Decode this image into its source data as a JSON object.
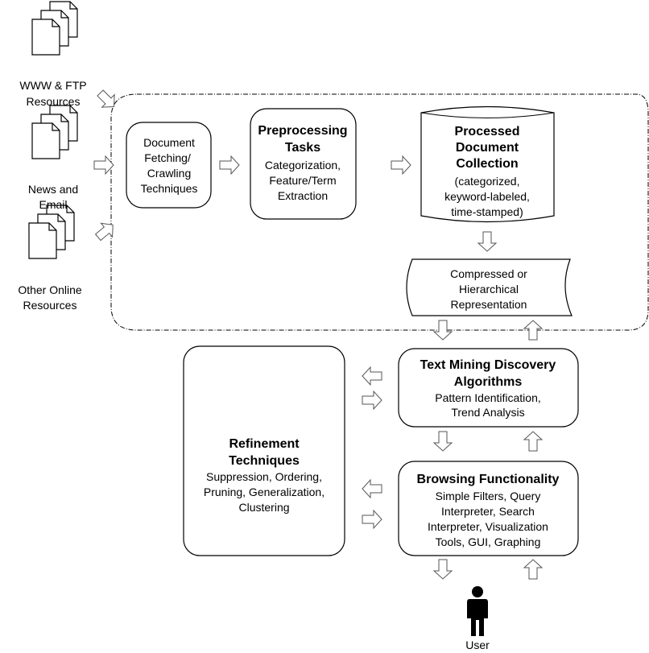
{
  "sources": [
    {
      "lines": [
        "WWW & FTP",
        "Resources"
      ]
    },
    {
      "lines": [
        "News and",
        "Email"
      ]
    },
    {
      "lines": [
        "Other Online",
        "Resources"
      ]
    }
  ],
  "fetching": {
    "lines": [
      "Document",
      "Fetching/",
      "Crawling",
      "Techniques"
    ]
  },
  "preprocessing": {
    "title": [
      "Preprocessing",
      "Tasks"
    ],
    "body": [
      "Categorization,",
      "Feature/Term",
      "Extraction"
    ]
  },
  "collection": {
    "title": [
      "Processed",
      "Document",
      "Collection"
    ],
    "body": [
      "(categorized,",
      "keyword-labeled,",
      "time-stamped)"
    ]
  },
  "representation": {
    "lines": [
      "Compressed or",
      "Hierarchical",
      "Representation"
    ]
  },
  "discovery": {
    "title": [
      "Text Mining Discovery",
      "Algorithms"
    ],
    "body": [
      "Pattern Identification,",
      "Trend Analysis"
    ]
  },
  "refinement": {
    "title": [
      "Refinement",
      "Techniques"
    ],
    "body": [
      "Suppression, Ordering,",
      "Pruning, Generalization,",
      "Clustering"
    ]
  },
  "browsing": {
    "title": [
      "Browsing Functionality"
    ],
    "body": [
      "Simple Filters, Query",
      "Interpreter, Search",
      "Interpreter, Visualization",
      "Tools, GUI, Graphing"
    ]
  },
  "user": {
    "label": "User",
    "icon": "person-icon"
  }
}
